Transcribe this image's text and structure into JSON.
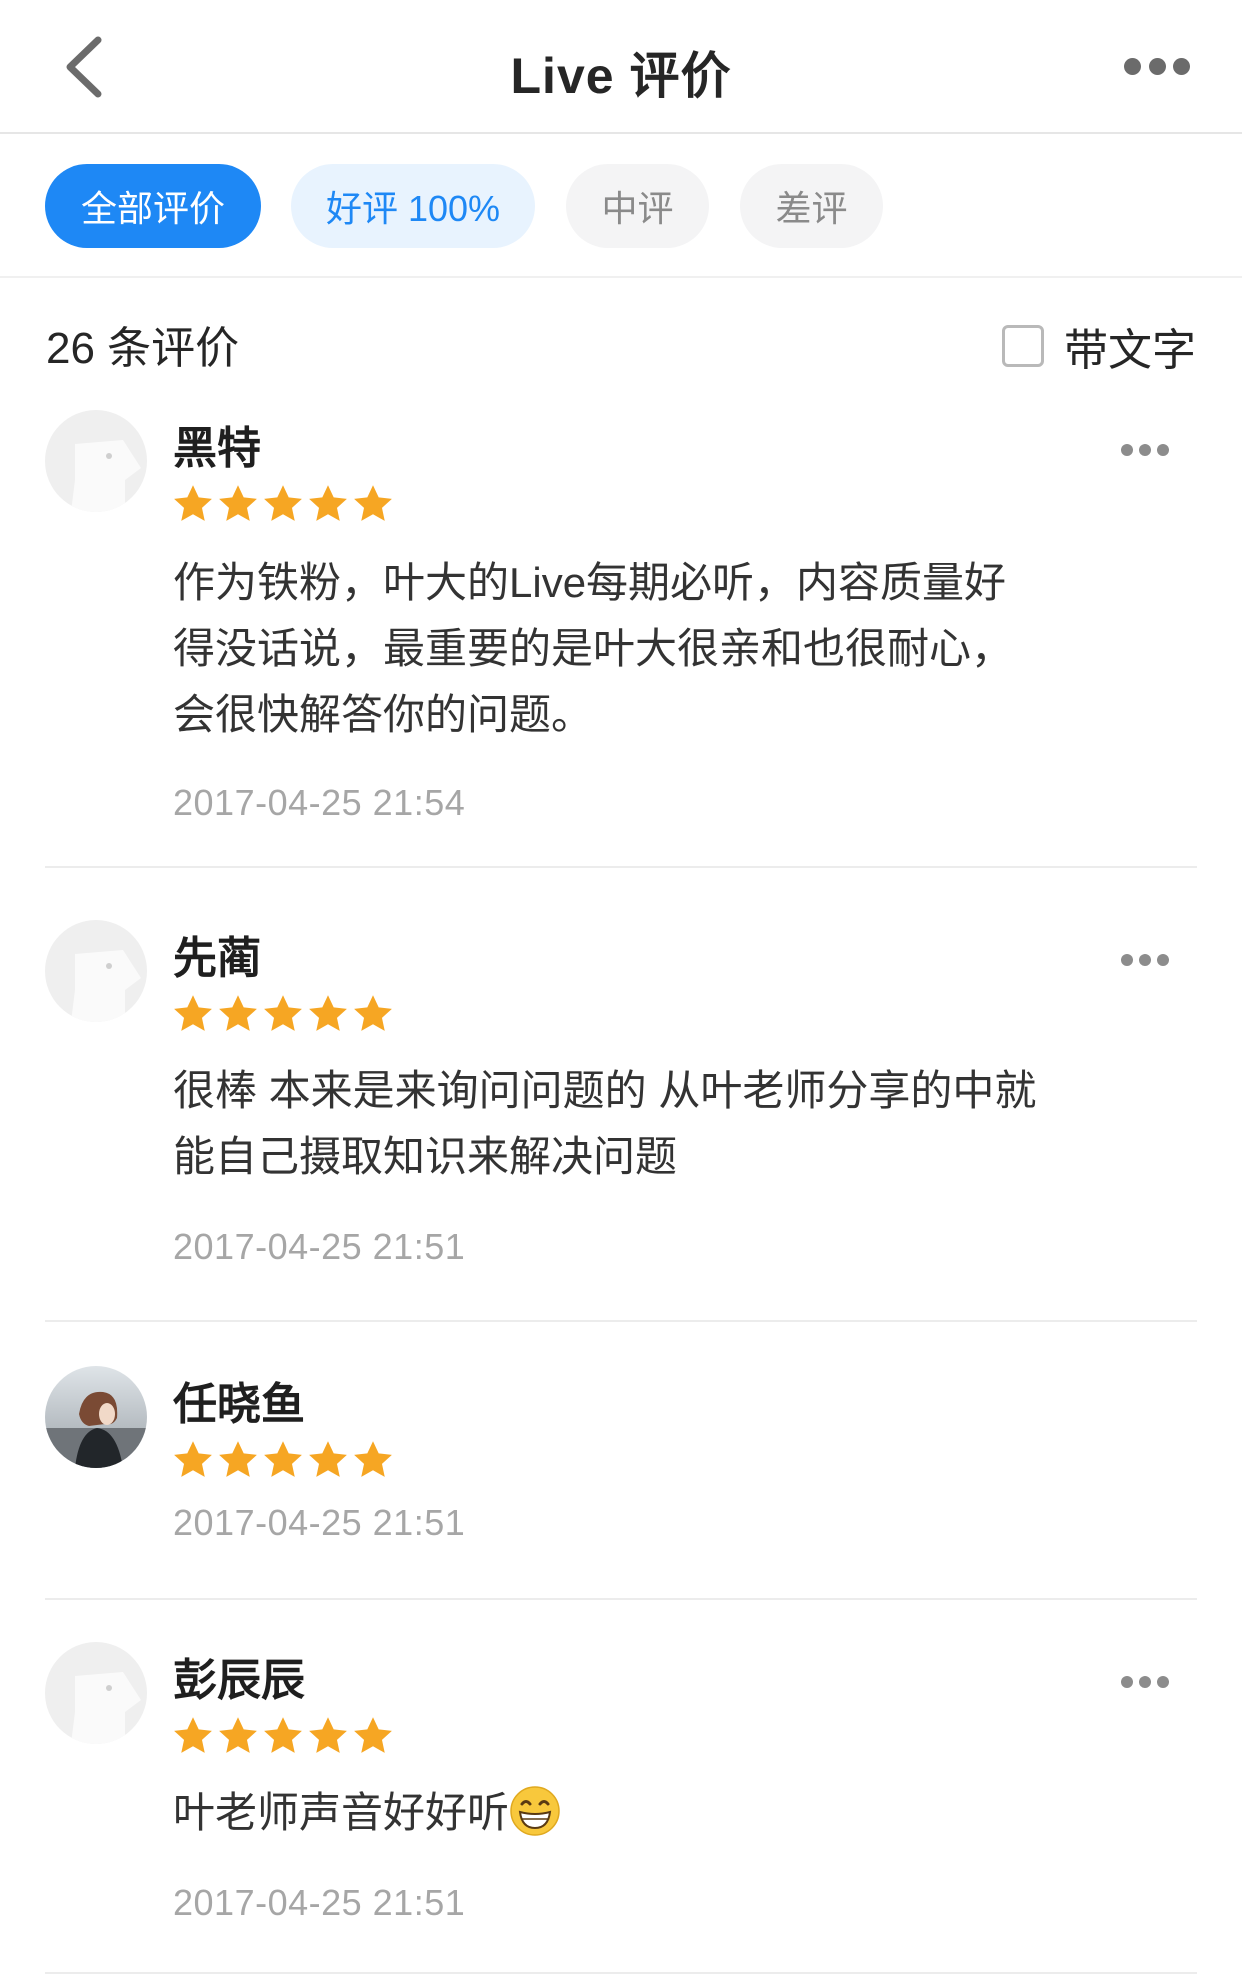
{
  "header": {
    "title": "Live 评价"
  },
  "filters": {
    "all": "全部评价",
    "good": "好评 100%",
    "mid": "中评",
    "bad": "差评"
  },
  "summary": {
    "count_text": "26 条评价",
    "text_only_label": "带文字"
  },
  "colors": {
    "accent": "#1e88f5",
    "star": "#f6a623"
  },
  "reviews": [
    {
      "name": "黑特",
      "rating": 5,
      "avatar": "default-avatar",
      "content_lines": [
        "作为铁粉，叶大的Live每期必听，内容质量好",
        "得没话说，最重要的是叶大很亲和也很耐心，",
        "会很快解答你的问题。"
      ],
      "date": "2017-04-25 21:54"
    },
    {
      "name": "先蔺",
      "rating": 5,
      "avatar": "default-avatar",
      "content_lines": [
        "很棒 本来是来询问问题的 从叶老师分享的中就",
        "能自己摄取知识来解决问题"
      ],
      "date": "2017-04-25 21:51"
    },
    {
      "name": "任晓鱼",
      "rating": 5,
      "avatar": "photo-avatar",
      "content_lines": [],
      "date": "2017-04-25 21:51"
    },
    {
      "name": "彭辰辰",
      "rating": 5,
      "avatar": "default-avatar",
      "content_lines": [
        "叶老师声音好好听"
      ],
      "emoji": "grinning-face-emoji",
      "date": "2017-04-25 21:51"
    }
  ]
}
